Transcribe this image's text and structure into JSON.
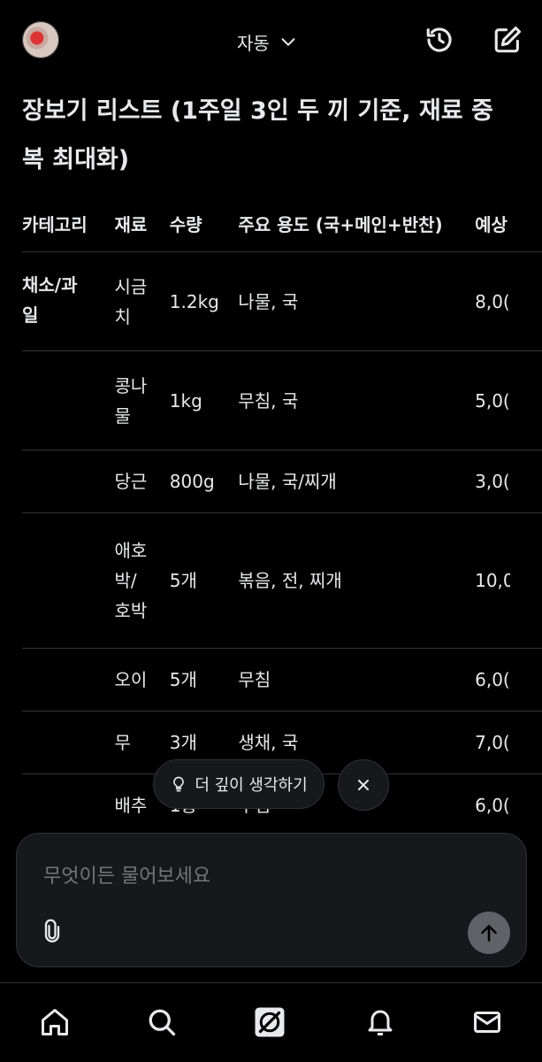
{
  "header": {
    "mode_label": "자동",
    "icons": [
      "avatar",
      "chevron-down-icon",
      "history-icon",
      "compose-icon"
    ]
  },
  "message": {
    "title_line1": "장보기 리스트 (1주일 3인 두 끼 기준, 재료 중",
    "title_line2": "복 최대화)"
  },
  "table": {
    "headers": [
      "카테고리",
      "재료",
      "수량",
      "주요 용도 (국+메인+반찬)",
      "예상"
    ],
    "rows": [
      {
        "category": [
          "채소/과",
          "일"
        ],
        "item": [
          "시금",
          "치"
        ],
        "qty": "1.2kg",
        "use": "나물, 국",
        "price": "8,0("
      },
      {
        "category": [],
        "item": [
          "콩나",
          "물"
        ],
        "qty": "1kg",
        "use": "무침, 국",
        "price": "5,0("
      },
      {
        "category": [],
        "item": [
          "당근"
        ],
        "qty": "800g",
        "use": "나물, 국/찌개",
        "price": "3,0("
      },
      {
        "category": [],
        "item": [
          "애호",
          "박/",
          "호박"
        ],
        "qty": "5개",
        "use": "볶음, 전, 찌개",
        "price": "10,0"
      },
      {
        "category": [],
        "item": [
          "오이"
        ],
        "qty": "5개",
        "use": "무침",
        "price": "6,0("
      },
      {
        "category": [],
        "item": [
          "무"
        ],
        "qty": "3개",
        "use": "생채, 국",
        "price": "7,0("
      },
      {
        "category": [],
        "item": [
          "배추"
        ],
        "qty": "1통",
        "use": "무침",
        "price": "6,0("
      }
    ]
  },
  "suggestion": {
    "chip_label": "더 깊이 생각하기"
  },
  "composer": {
    "placeholder": "무엇이든 물어보세요"
  },
  "nav": {
    "items": [
      "home-icon",
      "search-icon",
      "grok-icon",
      "notifications-icon",
      "messages-icon"
    ]
  },
  "colors": {
    "background": "#000000",
    "text": "#e7e9ea",
    "muted": "#71767b",
    "divider": "#2f3336",
    "surface": "#16181c"
  }
}
